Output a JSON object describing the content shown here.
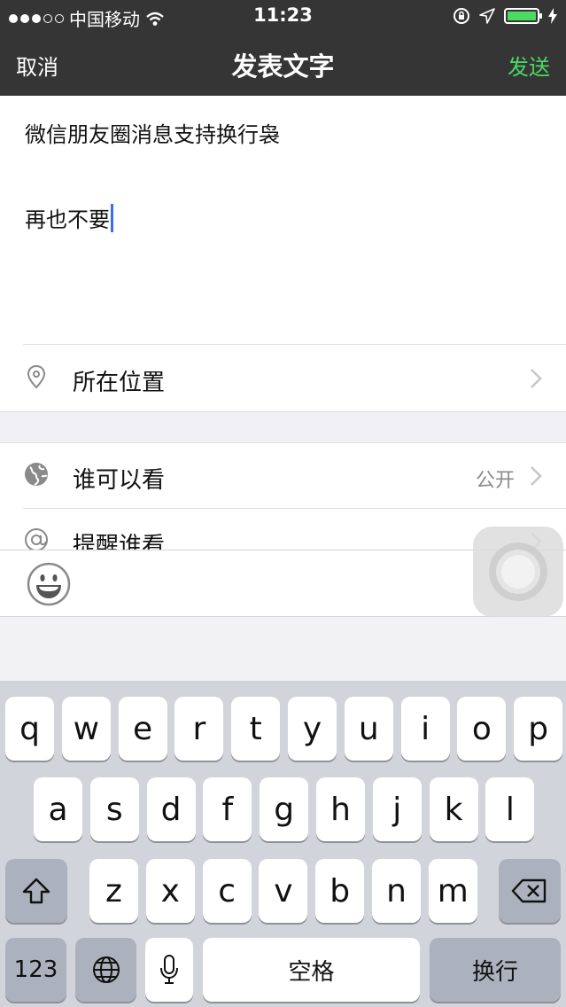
{
  "status_bar": {
    "carrier": "中国移动",
    "time": "11:23"
  },
  "nav": {
    "cancel_label": "取消",
    "title": "发表文字",
    "send_label": "发送",
    "send_color": "#4cd964"
  },
  "compose": {
    "line1": "微信朋友圈消息支持换行袅",
    "line2": "再也不要"
  },
  "location_row": {
    "icon": "location-pin-icon",
    "label": "所在位置"
  },
  "visibility_row": {
    "icon": "globe-icon",
    "label": "谁可以看",
    "value": "公开"
  },
  "mention_row": {
    "icon": "at-icon",
    "label": "提醒谁看"
  },
  "toolbar": {
    "icon": "emoji-icon"
  },
  "keyboard": {
    "row1": [
      "q",
      "w",
      "e",
      "r",
      "t",
      "y",
      "u",
      "i",
      "o",
      "p"
    ],
    "row2": [
      "a",
      "s",
      "d",
      "f",
      "g",
      "h",
      "j",
      "k",
      "l"
    ],
    "row3": [
      "z",
      "x",
      "c",
      "v",
      "b",
      "n",
      "m"
    ],
    "numbers_label": "123",
    "space_label": "空格",
    "return_label": "换行"
  }
}
